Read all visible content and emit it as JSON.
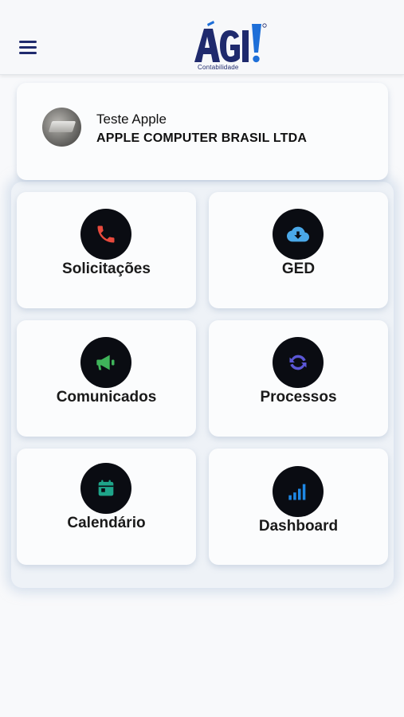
{
  "header": {
    "menu_icon": "hamburger-icon",
    "logo_text": "ÁGI",
    "logo_subtitle": "Contabilidade",
    "brand_color": "#1f2a6d",
    "accent_color": "#1e6fd8"
  },
  "profile": {
    "name": "Teste Apple",
    "company": "APPLE COMPUTER BRASIL LTDA"
  },
  "tiles": [
    {
      "label": "Solicitações",
      "icon": "phone-icon",
      "color": "#e84a3d"
    },
    {
      "label": "GED",
      "icon": "cloud-download-icon",
      "color": "#4aa8e8"
    },
    {
      "label": "Comunicados",
      "icon": "megaphone-icon",
      "color": "#3fb45a"
    },
    {
      "label": "Processos",
      "icon": "sync-icon",
      "color": "#5b57d6"
    },
    {
      "label": "Calendário",
      "icon": "calendar-icon",
      "color": "#1fa58a"
    },
    {
      "label": "Dashboard",
      "icon": "signal-bars-icon",
      "color": "#1e88e5"
    }
  ]
}
